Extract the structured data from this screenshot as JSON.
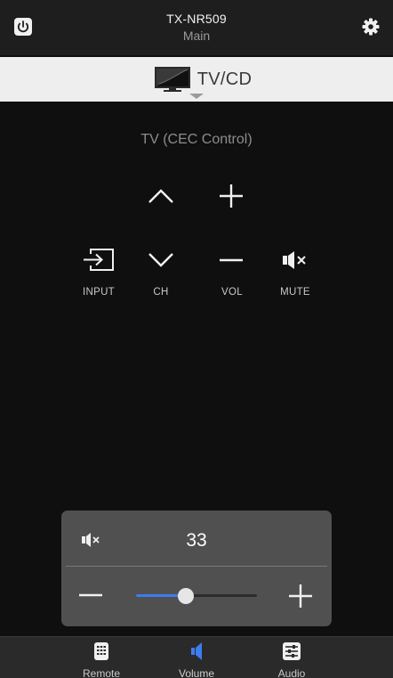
{
  "header": {
    "device_name": "TX-NR509",
    "zone": "Main",
    "power_icon": "power-icon",
    "settings_icon": "gear-icon"
  },
  "source": {
    "label": "TV/CD",
    "icon": "tv-icon"
  },
  "main": {
    "section_title": "TV (CEC Control)",
    "controls": {
      "input_label": "INPUT",
      "ch_label": "CH",
      "vol_label": "VOL",
      "mute_label": "MUTE"
    }
  },
  "volume": {
    "value": "33",
    "level_fraction": 0.41
  },
  "bottom_nav": {
    "items": [
      {
        "label": "Remote",
        "icon": "remote-icon"
      },
      {
        "label": "Volume",
        "icon": "speaker-icon",
        "active": true
      },
      {
        "label": "Audio",
        "icon": "equalizer-icon"
      }
    ]
  },
  "colors": {
    "accent": "#3d7cf2",
    "background": "#0f0f0f",
    "header_bg": "#1e1e1e",
    "source_bar_bg": "#eeeeee",
    "panel_bg": "#505050",
    "nav_bg": "#2a2a2a"
  }
}
